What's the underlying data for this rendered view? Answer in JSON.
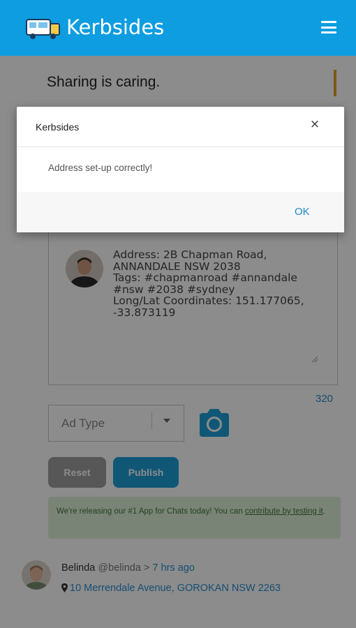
{
  "header": {
    "brand": "Kerbsides",
    "menu_icon": "hamburger-menu-icon",
    "logo_icon": "truck-logo-icon",
    "color": "#0e9de0"
  },
  "main": {
    "tagline": "Sharing is caring.",
    "post_text": "Address: 2B Chapman Road, ANNANDALE NSW 2038\nTags: #chapmanroad #annandale #nsw #2038 #sydney\nLong/Lat Coordinates: 151.177065, -33.873119",
    "char_count": "320",
    "ad_type_placeholder": "Ad Type",
    "reset_label": "Reset",
    "publish_label": "Publish",
    "notice_text": "We're releasing our #1 App for Chats today! You can ",
    "notice_link": "contribute by testing it",
    "notice_end": "."
  },
  "feed": {
    "name": "Belinda",
    "handle": "@belinda",
    "separator": ">",
    "time": "7 hrs ago",
    "location": "10 Merrendale Avenue, GOROKAN NSW 2263"
  },
  "dialog": {
    "title": "Kerbsides",
    "close": "×",
    "message": "Address set-up correctly!",
    "ok_label": "OK"
  }
}
